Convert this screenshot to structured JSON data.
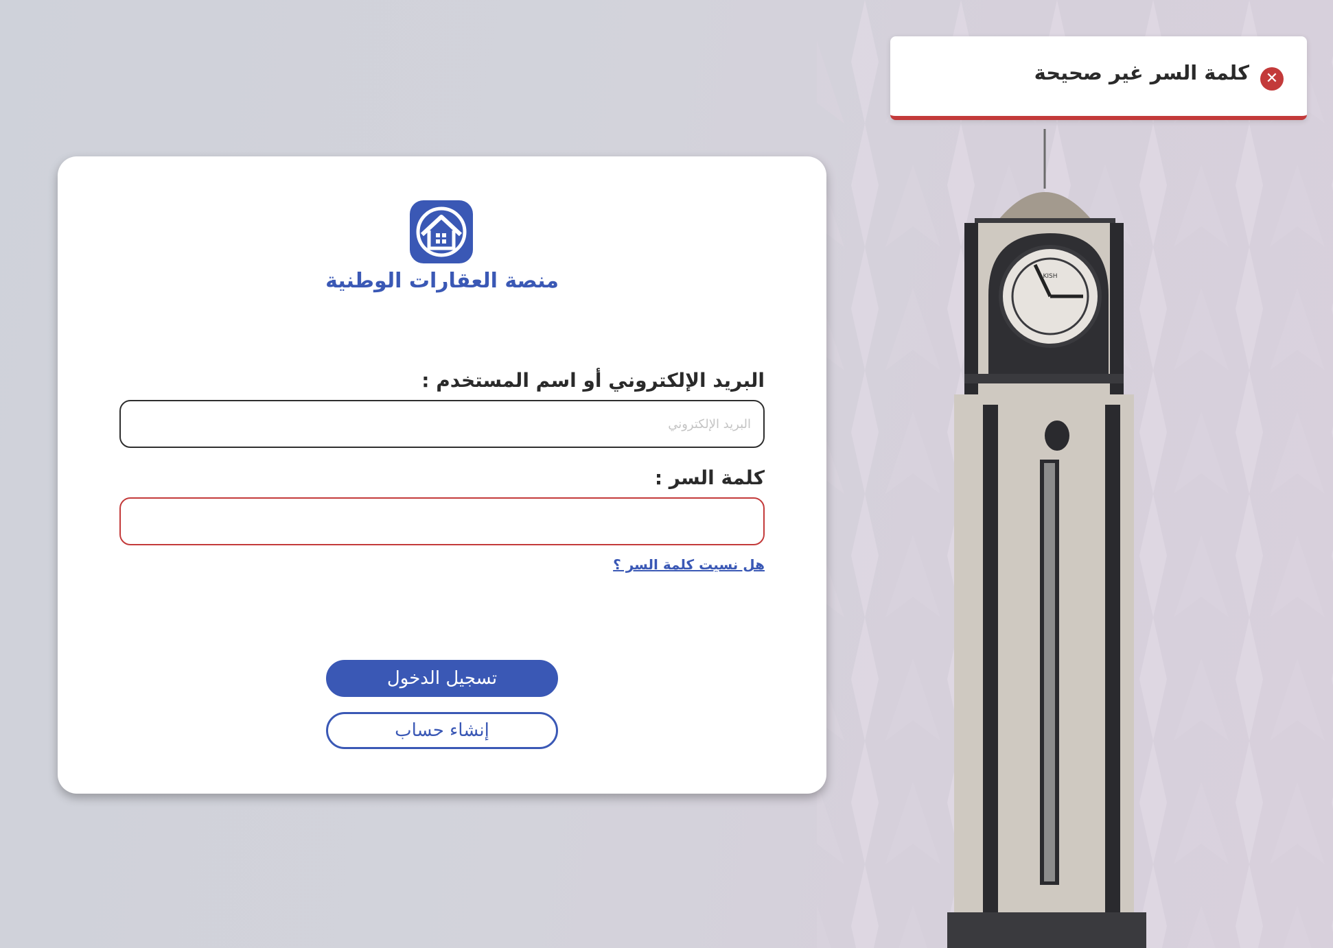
{
  "toast": {
    "message": "كلمة السر غير صحيحة",
    "icon": "error-icon",
    "color": "#c33a3a"
  },
  "brand": {
    "name": "منصة العقارات الوطنية",
    "color": "#3a58b5"
  },
  "form": {
    "email_label": "البريد الإلكتروني أو اسم المستخدم :",
    "email_placeholder": "البريد الإلكتروني",
    "email_value": "",
    "password_label": "كلمة السر :",
    "password_value": "",
    "forgot_link": "هل نسيت كلمة السر ؟",
    "login_button": "تسجيل الدخول",
    "signup_button": "إنشاء حساب"
  },
  "clock": {
    "face_text": "KISH"
  }
}
